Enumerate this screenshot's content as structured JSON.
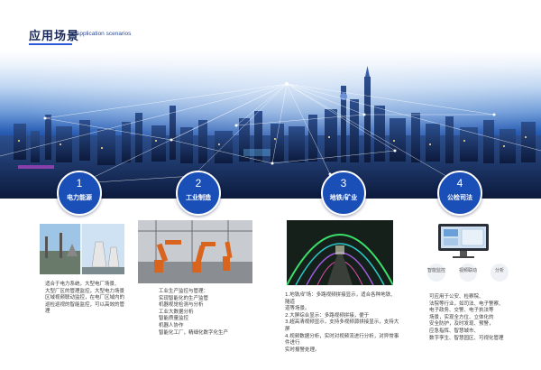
{
  "header": {
    "title": "应用场景",
    "subtitle": "Application scenarios"
  },
  "scenarios": [
    {
      "number": "1",
      "label": "电力能源",
      "text": [
        "适合于电力系统，大型电厂场景、",
        "大型厂区的管理监控，大型电力场景",
        "区域视频联动监控，在电厂区域内的",
        "巡检巡视的智能监控，可以高效的管理"
      ]
    },
    {
      "number": "2",
      "label": "工业制造",
      "text": [
        "工业生产监控与管理：",
        "实现智能化的生产监管",
        "机器视觉检测与分析",
        "工业大数据分析",
        "智能质量监控",
        "机器人协作",
        "智能化工厂，精细化数字化生产"
      ]
    },
    {
      "number": "3",
      "label": "地铁/矿业",
      "text": [
        "1.地铁/矿场：多路视频拼接显示，适合各种地铁、隧道",
        "道等场景。",
        "2.大屏综合显示：多路视频拼接，便于",
        "3.超高清视频显示，支持多视频源拼接显示，支持大屏",
        "4.视频数据分析，实时对视频流进行分析，对异常事件进行",
        "实时报警处理。"
      ]
    },
    {
      "number": "4",
      "label": "公检司法",
      "icons": [
        "智能监控",
        "视频联动",
        "分析"
      ],
      "text": [
        "可应用于公安、检察院、",
        "法院等行业，如司法、电子警察、",
        "电子政务、交警、电子执法等",
        "场景，实现全方位、立体化的",
        "安全防护，及时发现、预警，",
        "应急指挥、智慧城市、",
        "数字孪生、智慧园区、可视化管理"
      ]
    }
  ],
  "colors": {
    "accent": "#1b4fb8",
    "title": "#1a2a5a"
  }
}
